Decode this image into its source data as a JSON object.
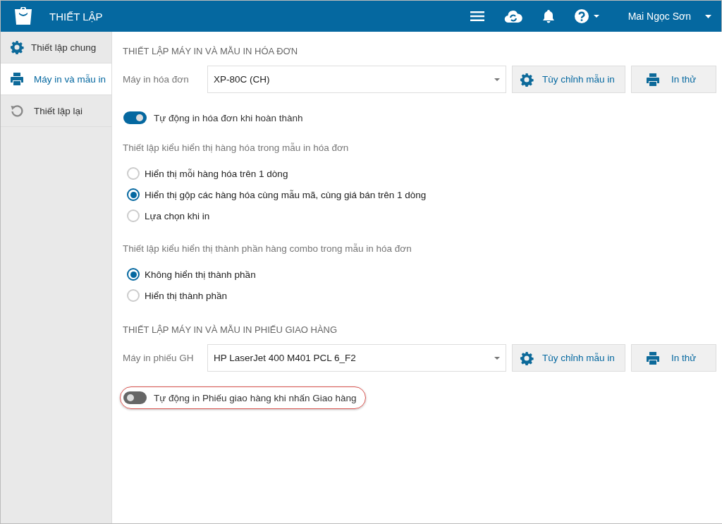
{
  "header": {
    "title": "THIẾT LẬP",
    "user_name": "Mai Ngọc Sơn"
  },
  "sidebar": {
    "items": [
      {
        "label": "Thiết lập chung",
        "kind": "gear",
        "selected": false
      },
      {
        "label": "Máy in và mẫu in",
        "kind": "printer",
        "selected": true
      },
      {
        "label": "Thiết lập lại",
        "kind": "reset",
        "selected": false
      }
    ]
  },
  "sections": [
    {
      "title": "THIẾT LẬP MÁY IN VÀ MẪU IN HÓA ĐƠN",
      "printer_label": "Máy in hóa đơn",
      "printer_value": "XP-80C (CH)",
      "buttons": [
        {
          "label": "Tùy chỉnh mẫu in",
          "kind": "gear"
        },
        {
          "label": "In thử",
          "kind": "printer"
        }
      ],
      "toggle": {
        "label": "Tự động in hóa đơn khi hoàn thành",
        "on": true,
        "highlighted": false
      },
      "groups": [
        {
          "title": "Thiết lập kiểu hiển thị hàng hóa trong mẫu in hóa đơn",
          "options": [
            {
              "label": "Hiển thị mỗi hàng hóa trên 1 dòng",
              "selected": false
            },
            {
              "label": "Hiển thị gộp các hàng hóa cùng mẫu mã, cùng giá bán trên 1 dòng",
              "selected": true
            },
            {
              "label": "Lựa chọn khi in",
              "selected": false
            }
          ]
        },
        {
          "title": "Thiết lập kiểu hiển thị thành phần hàng combo trong mẫu in hóa đơn",
          "options": [
            {
              "label": "Không hiển thị thành phần",
              "selected": true
            },
            {
              "label": "Hiển thị thành phần",
              "selected": false
            }
          ]
        }
      ]
    },
    {
      "title": "THIẾT LẬP MÁY IN VÀ MẪU IN PHIẾU GIAO HÀNG",
      "printer_label": "Máy in phiếu GH",
      "printer_value": "HP LaserJet 400 M401 PCL 6_F2",
      "buttons": [
        {
          "label": "Tùy chỉnh mẫu in",
          "kind": "gear"
        },
        {
          "label": "In thử",
          "kind": "printer"
        }
      ],
      "toggle": {
        "label": "Tự động in Phiếu giao hàng khi nhấn Giao hàng",
        "on": false,
        "highlighted": true
      }
    }
  ]
}
